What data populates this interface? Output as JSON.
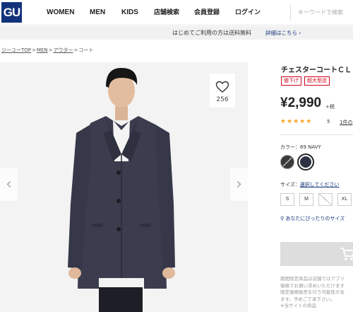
{
  "header": {
    "logo": "GU",
    "nav": [
      "WOMEN",
      "MEN",
      "KIDS",
      "店舗検索",
      "会員登録",
      "ログイン"
    ],
    "search_placeholder": "キーワードで検索"
  },
  "banner": {
    "text": "はじめてご利用の方は送料無料",
    "link": "詳細はこちら ›"
  },
  "breadcrumb": [
    "ジーユーTOP",
    "MEN",
    "アウター",
    "コート"
  ],
  "product": {
    "favorite_count": "256",
    "title": "チェスターコートＣＬ",
    "badges": [
      "値下げ",
      "超大型店"
    ],
    "price": "¥2,990",
    "tax": "+税",
    "stars": "★★★★★",
    "rating": "5",
    "reviews": "1件の",
    "color_label": "カラー：69 NAVY",
    "size_label": "サイズ：",
    "size_link": "選択してください",
    "sizes": [
      "S",
      "M",
      "L",
      "XL"
    ],
    "fit_link": "あなたにぴったりのサイズ",
    "notice_lines": [
      "期間限定商品は店舗ではアプリ",
      "価格でお買い求めいただけます",
      "限定価格販売を行う可能性があ",
      "ます。予めご了承下さい。",
      "※当サイトの商品"
    ]
  },
  "colors": {
    "logo_bg": "#12337b",
    "accent": "#d0021b",
    "star": "#f5a623",
    "swatch_navy": "#2e3142",
    "swatch_charcoal": "#3a3a3a"
  }
}
